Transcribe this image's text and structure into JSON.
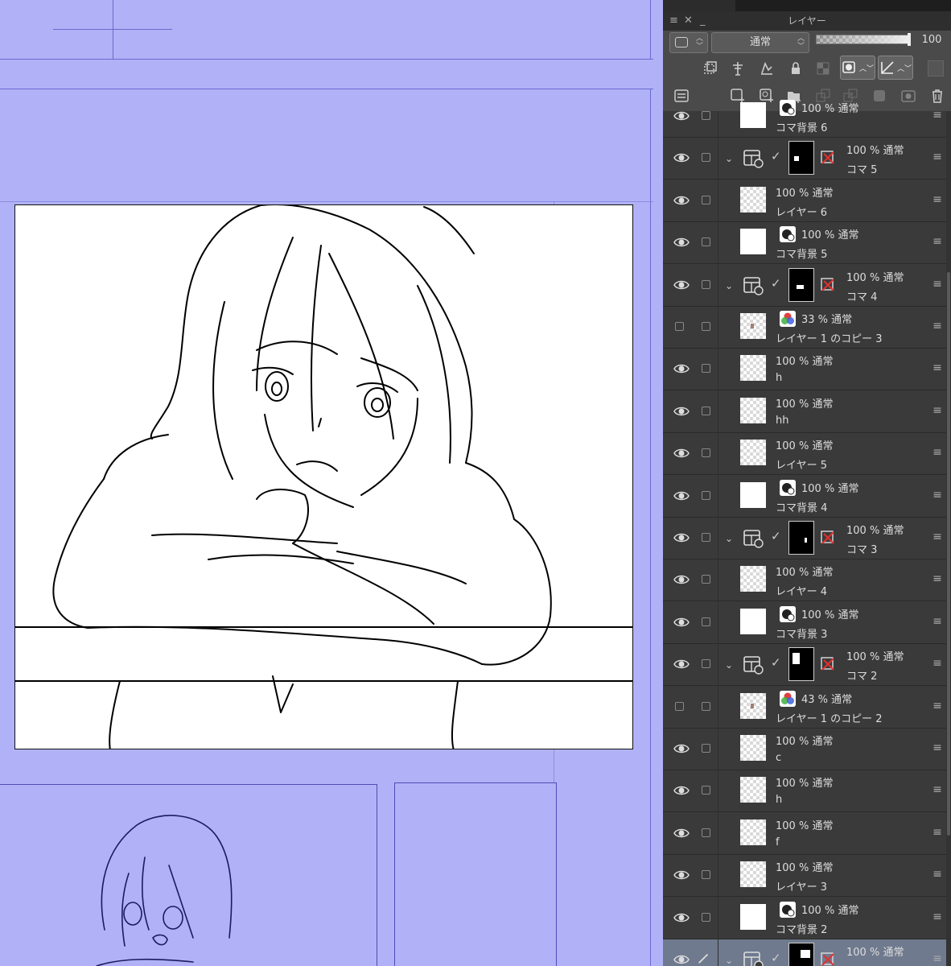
{
  "panel": {
    "title": "レイヤー",
    "blend_mode": "通常",
    "opacity_value": "100"
  },
  "layers": [
    {
      "pct": "100 %",
      "mode": "通常",
      "name": "コマ背景 6",
      "type": "bg"
    },
    {
      "pct": "100 %",
      "mode": "通常",
      "name": "コマ 5",
      "type": "folder",
      "expanded": true
    },
    {
      "pct": "100 %",
      "mode": "通常",
      "name": "レイヤー 6",
      "type": "raster"
    },
    {
      "pct": "100 %",
      "mode": "通常",
      "name": "コマ背景 5",
      "type": "bg"
    },
    {
      "pct": "100 %",
      "mode": "通常",
      "name": "コマ 4",
      "type": "folder",
      "expanded": true
    },
    {
      "pct": "33 %",
      "mode": "通常",
      "name": "レイヤー 1 のコピー 3",
      "type": "color",
      "hidden": true
    },
    {
      "pct": "100 %",
      "mode": "通常",
      "name": "h",
      "type": "raster"
    },
    {
      "pct": "100 %",
      "mode": "通常",
      "name": "hh",
      "type": "raster"
    },
    {
      "pct": "100 %",
      "mode": "通常",
      "name": "レイヤー 5",
      "type": "raster"
    },
    {
      "pct": "100 %",
      "mode": "通常",
      "name": "コマ背景 4",
      "type": "bg"
    },
    {
      "pct": "100 %",
      "mode": "通常",
      "name": "コマ 3",
      "type": "folder",
      "expanded": true
    },
    {
      "pct": "100 %",
      "mode": "通常",
      "name": "レイヤー 4",
      "type": "raster"
    },
    {
      "pct": "100 %",
      "mode": "通常",
      "name": "コマ背景 3",
      "type": "bg"
    },
    {
      "pct": "100 %",
      "mode": "通常",
      "name": "コマ 2",
      "type": "folder",
      "expanded": true
    },
    {
      "pct": "43 %",
      "mode": "通常",
      "name": "レイヤー 1 のコピー 2",
      "type": "color",
      "hidden": true
    },
    {
      "pct": "100 %",
      "mode": "通常",
      "name": "c",
      "type": "raster"
    },
    {
      "pct": "100 %",
      "mode": "通常",
      "name": "h",
      "type": "raster"
    },
    {
      "pct": "100 %",
      "mode": "通常",
      "name": "f",
      "type": "raster"
    },
    {
      "pct": "100 %",
      "mode": "通常",
      "name": "レイヤー 3",
      "type": "raster"
    },
    {
      "pct": "100 %",
      "mode": "通常",
      "name": "コマ背景 2",
      "type": "bg"
    },
    {
      "pct": "100 %",
      "mode": "通常",
      "name": "",
      "type": "folder",
      "selected": true
    }
  ],
  "colors": {
    "canvas_bg": "#b1b1f7",
    "panel_bg": "#3a3a3a",
    "selected_row": "#6f7a8e"
  }
}
